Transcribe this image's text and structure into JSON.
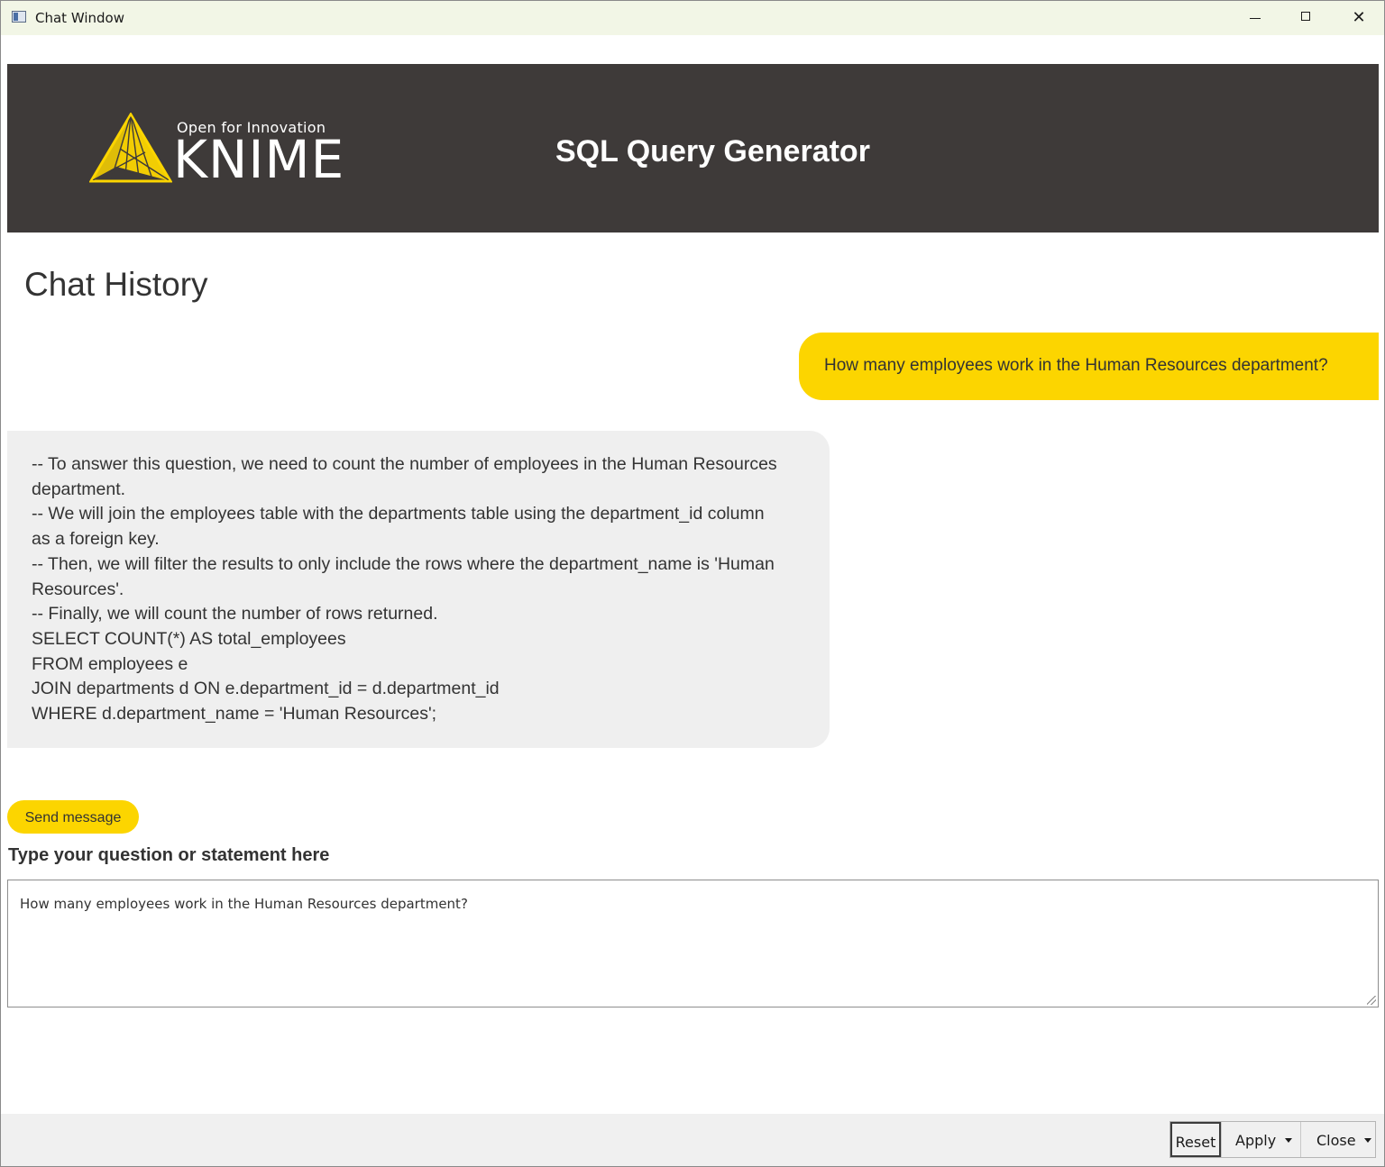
{
  "window": {
    "title": "Chat Window",
    "controls": [
      "minimize",
      "maximize",
      "close"
    ]
  },
  "header": {
    "logo_tagline": "Open for Innovation",
    "logo_wordmark": "KNIME",
    "title": "SQL Query Generator",
    "background_color": "#3e3a39",
    "accent_color": "#fcd500"
  },
  "chat": {
    "heading": "Chat History",
    "messages": [
      {
        "role": "user",
        "text": "How many employees work in the Human Resources department?"
      },
      {
        "role": "assistant",
        "lines": [
          "-- To answer this question, we need to count the number of employees in the Human Resources",
          "department.",
          "-- We will join the employees table with the departments table using the department_id column",
          "as a foreign key.",
          "-- Then, we will filter the results to only include the rows where the department_name is 'Human",
          "Resources'.",
          "-- Finally, we will count the number of rows returned.",
          "SELECT COUNT(*) AS total_employees",
          "FROM employees e",
          "JOIN departments d ON e.department_id = d.department_id",
          "WHERE d.department_name = 'Human Resources';"
        ]
      }
    ]
  },
  "composer": {
    "send_label": "Send message",
    "input_label": "Type your question or statement here",
    "input_value": "How many employees work in the Human Resources department?"
  },
  "footer": {
    "reset_label": "Reset",
    "apply_label": "Apply",
    "close_label": "Close"
  }
}
